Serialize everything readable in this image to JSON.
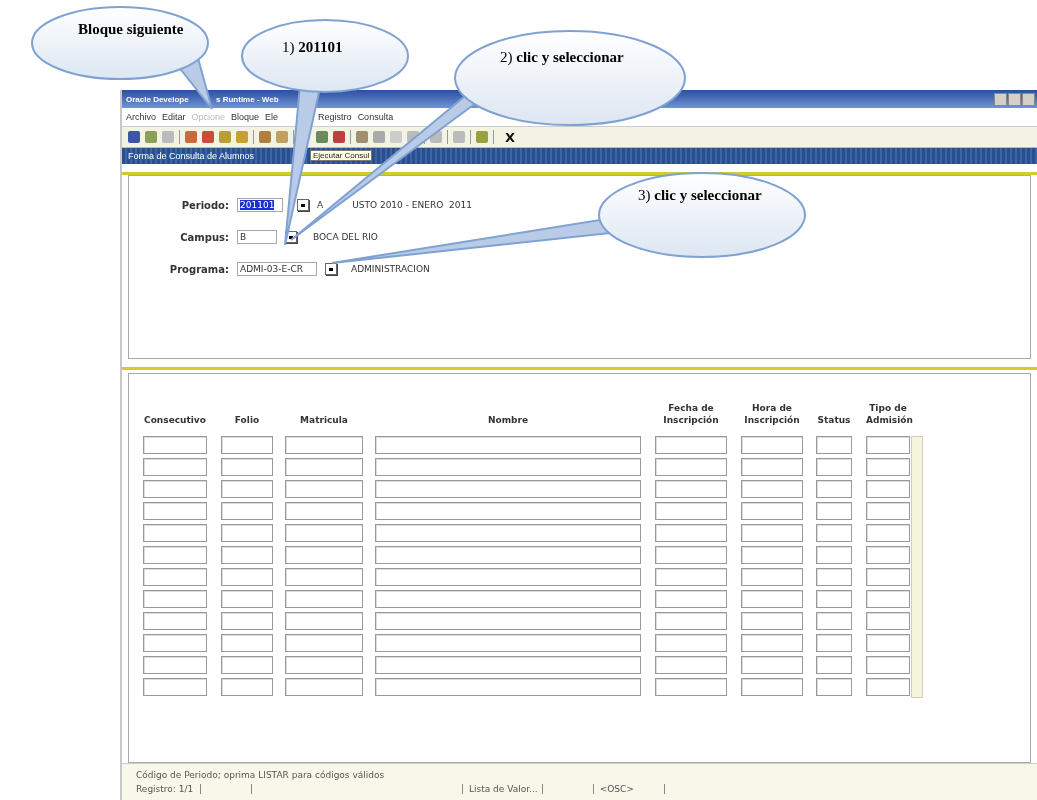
{
  "window": {
    "title_parts": [
      "Oracle Develope",
      "s Runtime - Web"
    ]
  },
  "menu": [
    {
      "label": "Archivo",
      "disabled": false
    },
    {
      "label": "Editar",
      "disabled": false
    },
    {
      "label": "Opcione",
      "disabled": true
    },
    {
      "label": "Bloque",
      "disabled": false
    },
    {
      "label": "Ele",
      "disabled": false
    },
    {
      "label": "Registro",
      "disabled": false
    },
    {
      "label": "Consulta",
      "disabled": false
    }
  ],
  "toolbar": {
    "exit_label": "X"
  },
  "form": {
    "title": "Forma de Consulta de Alumnos",
    "tooltip": "Ejecutar Consul",
    "fields": [
      {
        "label": "Periodo:",
        "value": "201101",
        "description_parts": [
          "A",
          "USTO 2010 - ENERO  2011"
        ],
        "highlighted": true
      },
      {
        "label": "Campus:",
        "value": "B",
        "description_parts": [
          "BOCA DEL RIO"
        ],
        "highlighted": false
      },
      {
        "label": "Programa:",
        "value": "ADMI-03-E-CR",
        "description_parts": [
          "ADMINISTRACION"
        ],
        "highlighted": false
      }
    ]
  },
  "table": {
    "columns": [
      "Consecutivo",
      "Folio",
      "Matricula",
      "Nombre",
      "Fecha de Inscripción",
      "Hora de Inscripción",
      "Status",
      "Tipo de Admisión"
    ]
  },
  "status_bar": {
    "message": "Código de Periodo; oprima LISTAR para códigos válidos",
    "record": "Registro: 1/1",
    "list_hint": "Lista de Valor...",
    "mode": "<OSC>"
  },
  "callouts": [
    {
      "text": "Bloque siguiente"
    },
    {
      "text": "1) **201101**"
    },
    {
      "text": "2) **clic y seleccionar**"
    },
    {
      "text": "3) **clic y seleccionar**"
    }
  ]
}
